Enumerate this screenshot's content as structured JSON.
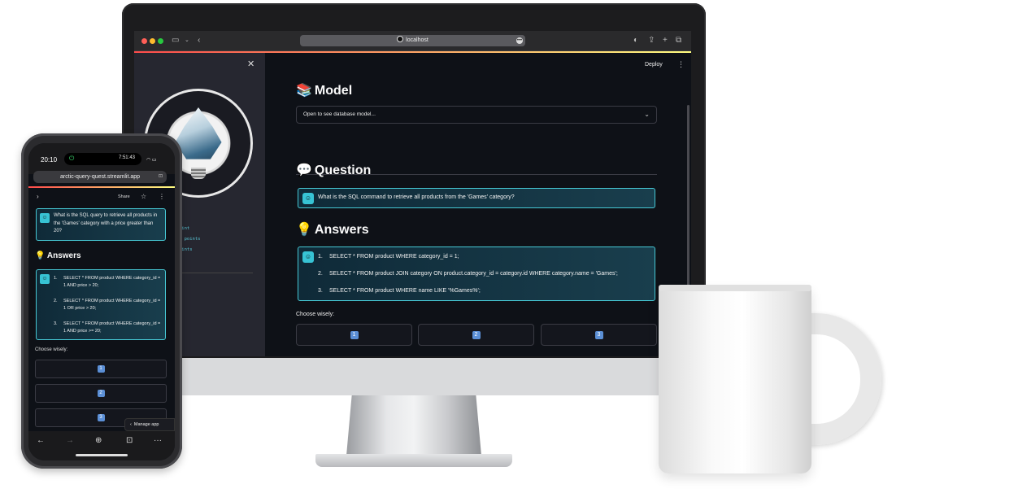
{
  "desktop": {
    "browser": {
      "url": "localhost"
    },
    "deploy_label": "Deploy",
    "kebab_glyph": "⋮",
    "close_glyph": "✕",
    "sidebar_points": [
      "oint",
      "2 points",
      "oints"
    ],
    "model": {
      "emoji": "📚",
      "title": "Model",
      "expander_label": "Open to see database model..."
    },
    "question": {
      "emoji": "💬",
      "title": "Question",
      "text": "What is the SQL command to retrieve all products from the 'Games' category?"
    },
    "answers": {
      "emoji": "💡",
      "title": "Answers",
      "items": [
        {
          "num": "1.",
          "text": "SELECT * FROM product WHERE category_id = 1;"
        },
        {
          "num": "2.",
          "text": "SELECT * FROM product JOIN category ON product.category_id = category.id WHERE category.name = 'Games';"
        },
        {
          "num": "3.",
          "text": "SELECT * FROM product WHERE name LIKE '%Games%';"
        }
      ]
    },
    "choose_label": "Choose wisely:",
    "choices": [
      "1",
      "2",
      "3"
    ]
  },
  "mobile": {
    "status_time": "20:10",
    "island_time": "7:51:43",
    "url": "arctic-query-quest.streamlit.app",
    "share_label": "Share",
    "question_text": "What is the SQL query to retrieve all products in the 'Games' category with a price greater than 20?",
    "answers_title": "Answers",
    "answers": [
      {
        "num": "1.",
        "text": "SELECT * FROM product WHERE category_id = 1 AND price > 20;"
      },
      {
        "num": "2.",
        "text": "SELECT * FROM product WHERE category_id = 1 OR price > 20;"
      },
      {
        "num": "3.",
        "text": "SELECT * FROM product WHERE category_id = 1 AND price >= 20;"
      }
    ],
    "choose_label": "Choose wisely:",
    "choices": [
      "1",
      "2",
      "3"
    ],
    "manage_app_label": "Manage app"
  },
  "colors": {
    "accent_cyan": "#46c8d4",
    "background": "#0e1117",
    "sidebar": "#262730",
    "keycap_blue": "#5b8fd6"
  }
}
